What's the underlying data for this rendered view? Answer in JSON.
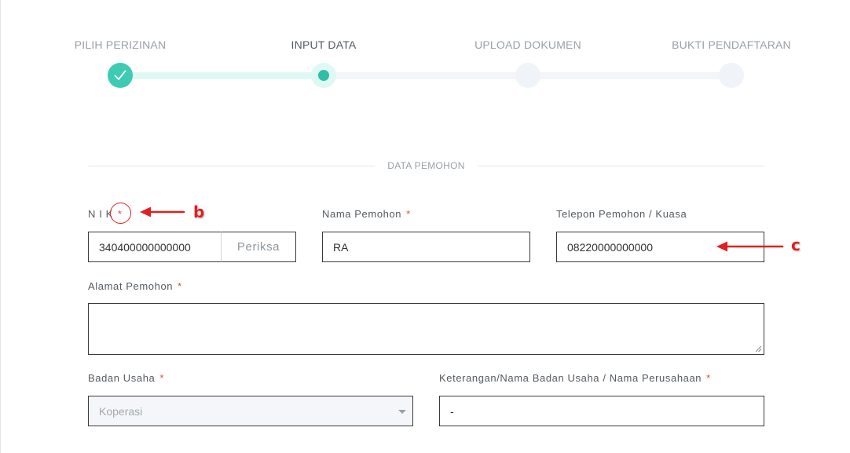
{
  "stepper": {
    "steps": [
      {
        "label": "PILIH PERIZINAN",
        "state": "done"
      },
      {
        "label": "INPUT DATA",
        "state": "current"
      },
      {
        "label": "UPLOAD DOKUMEN",
        "state": "todo"
      },
      {
        "label": "BUKTI PENDAFTARAN",
        "state": "todo"
      }
    ],
    "done_icon": "check-icon"
  },
  "section": {
    "title": "DATA PEMOHON"
  },
  "form": {
    "nik": {
      "label": "N I K",
      "required": "*",
      "value": "340400000000000",
      "button": "Periksa"
    },
    "nama": {
      "label": "Nama Pemohon",
      "required": "*",
      "value": "RA"
    },
    "telepon": {
      "label": "Telepon Pemohon / Kuasa",
      "value": "08220000000000"
    },
    "alamat": {
      "label": "Alamat Pemohon",
      "required": "*",
      "value": ""
    },
    "badan_usaha": {
      "label": "Badan Usaha",
      "required": "*",
      "selected": "Koperasi"
    },
    "keterangan": {
      "label": "Keterangan/Nama Badan Usaha / Nama Perusahaan",
      "required": "*",
      "value": "-"
    }
  },
  "annotations": {
    "b": {
      "letter": "b"
    },
    "c": {
      "letter": "c"
    },
    "color": "#e02020"
  },
  "colors": {
    "accent": "#3ecbb3",
    "required": "#e0454b"
  }
}
